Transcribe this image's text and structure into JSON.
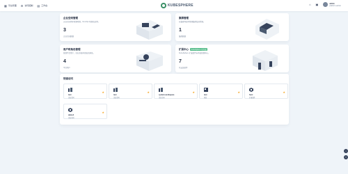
{
  "topbar": {
    "nav": [
      {
        "icon": "platform-icon",
        "glyph": "▦",
        "label": "平台管理"
      },
      {
        "icon": "access-icon",
        "glyph": "⚙",
        "label": "访问控制"
      },
      {
        "icon": "workbench-icon",
        "glyph": "▤",
        "label": "工作台"
      }
    ],
    "logo_text": "KUBESPHERE",
    "user": {
      "name": "admin",
      "role": "platform-admin"
    }
  },
  "cards": [
    {
      "title": "企业空间管理",
      "desc": "企业空间用于管理项目、DevOps 项目和应用。",
      "value": "3",
      "unit": "企业空间数量",
      "badge": ""
    },
    {
      "title": "集群管理",
      "desc": "在集群列表中管理集群及其资源。",
      "value": "1",
      "unit": "集群数量",
      "badge": ""
    },
    {
      "title": "用户和角色管理",
      "desc": "管理平台用户、已在系统中授权的角色。",
      "value": "4",
      "unit": "平台用户",
      "badge": ""
    },
    {
      "title": "扩展中心",
      "desc": "KubeSphere 扩展组件市场和管理中心。",
      "value": "7",
      "unit": "已安装组件",
      "badge": "KubeSphere 已完成"
    }
  ],
  "quick": {
    "title": "快速访问",
    "tiles": [
      {
        "name": "test",
        "sub": "企业空间",
        "icon": "workspace-icon"
      },
      {
        "name": "test",
        "sub": "企业空间",
        "icon": "workspace-icon"
      },
      {
        "name": "system-workspace",
        "sub": "企业空间",
        "icon": "workspace-icon"
      },
      {
        "name": "test",
        "sub": "项目",
        "icon": "project-icon"
      },
      {
        "name": "host",
        "sub": "扩展组件",
        "icon": "extension-icon"
      },
      {
        "name": "demo4",
        "sub": "企业空间",
        "icon": "extension-icon"
      }
    ]
  },
  "colors": {
    "accent": "#55bc8a",
    "star": "#f5a623",
    "background": "#eff4f9",
    "dark": "#36435c"
  }
}
